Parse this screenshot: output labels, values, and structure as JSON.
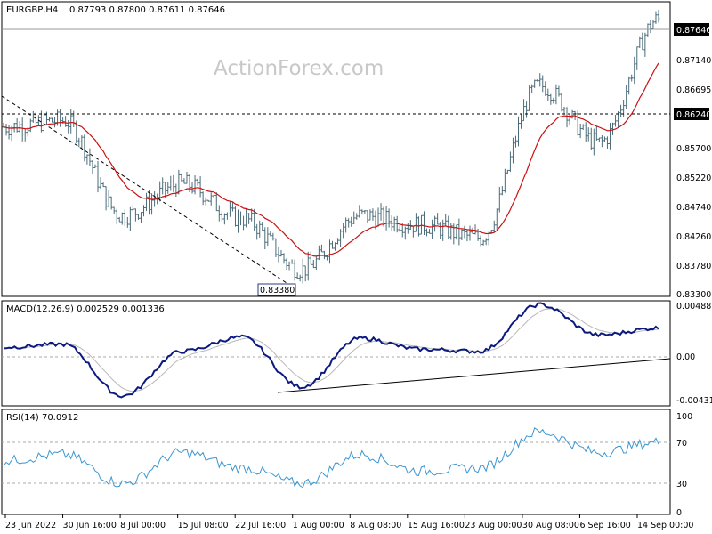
{
  "header": {
    "symbol": "EURGBP,H4",
    "ohlc": "0.87793 0.87800 0.87611 0.87646"
  },
  "watermark": "ActionForex.com",
  "price_panel": {
    "last_price_label": "0.87646",
    "level_label": "0.86240",
    "low_label": "0.83380",
    "y_ticks": [
      "0.87140",
      "0.86695",
      "0.86240",
      "0.85700",
      "0.85220",
      "0.84740",
      "0.84260",
      "0.83780",
      "0.83300"
    ]
  },
  "macd_panel": {
    "title": "MACD(12,26,9) 0.002529 0.001336",
    "y_ticks": [
      "0.004885",
      "0.00",
      "-0.004315"
    ]
  },
  "rsi_panel": {
    "title": "RSI(14) 70.0912",
    "y_ticks": [
      "100",
      "70",
      "30",
      "0"
    ]
  },
  "x_labels": [
    "23 Jun 2022",
    "30 Jun 16:00",
    "8 Jul 00:00",
    "15 Jul 08:00",
    "22 Jul 16:00",
    "1 Aug 00:00",
    "8 Aug 08:00",
    "15 Aug 16:00",
    "23 Aug 00:00",
    "30 Aug 08:00",
    "6 Sep 16:00",
    "14 Sep 00:00"
  ],
  "colors": {
    "bars": "#4a6b78",
    "ma": "#cc1111",
    "macd": "#0c1a80",
    "signal": "#b8b8b8",
    "rsi": "#3a96d2",
    "trend": "#000000",
    "tag_bg": "#000000"
  },
  "chart_data": [
    {
      "type": "line",
      "title": "EURGBP,H4",
      "ylim": [
        0.833,
        0.879
      ],
      "x": [
        "23 Jun 2022",
        "30 Jun 16:00",
        "8 Jul 00:00",
        "15 Jul 08:00",
        "22 Jul 16:00",
        "1 Aug 00:00",
        "8 Aug 08:00",
        "15 Aug 16:00",
        "23 Aug 00:00",
        "30 Aug 08:00",
        "6 Sep 16:00",
        "14 Sep 00:00"
      ],
      "series": [
        {
          "name": "EURGBP,H4",
          "values": [
            0.8595,
            0.8605,
            0.8455,
            0.8505,
            0.845,
            0.837,
            0.8455,
            0.844,
            0.842,
            0.866,
            0.857,
            0.8765
          ]
        }
      ],
      "annotations": [
        "0.83380",
        "0.86240",
        "0.87646"
      ]
    },
    {
      "type": "line",
      "title": "MACD(12,26,9) 0.002529 0.001336",
      "ylim": [
        -0.005,
        0.005
      ],
      "x": [
        "23 Jun 2022",
        "30 Jun 16:00",
        "8 Jul 00:00",
        "15 Jul 08:00",
        "22 Jul 16:00",
        "1 Aug 00:00",
        "8 Aug 08:00",
        "15 Aug 16:00",
        "23 Aug 00:00",
        "30 Aug 08:00",
        "6 Sep 16:00",
        "14 Sep 00:00"
      ],
      "series": [
        {
          "name": "MACD(12,26,9)",
          "values": [
            0.0006,
            0.0009,
            -0.0042,
            0.0002,
            0.0016,
            -0.0033,
            0.0015,
            0.0004,
            0.0002,
            0.0048,
            0.0018,
            0.0025
          ]
        }
      ]
    },
    {
      "type": "line",
      "title": "RSI(14) 70.0912",
      "ylim": [
        0,
        100
      ],
      "x": [
        "23 Jun 2022",
        "30 Jun 16:00",
        "8 Jul 00:00",
        "15 Jul 08:00",
        "22 Jul 16:00",
        "1 Aug 00:00",
        "8 Aug 08:00",
        "15 Aug 16:00",
        "23 Aug 00:00",
        "30 Aug 08:00",
        "6 Sep 16:00",
        "14 Sep 00:00"
      ],
      "series": [
        {
          "name": "RSI(14)",
          "values": [
            52,
            58,
            30,
            60,
            45,
            30,
            58,
            42,
            45,
            80,
            60,
            70
          ]
        }
      ]
    }
  ]
}
